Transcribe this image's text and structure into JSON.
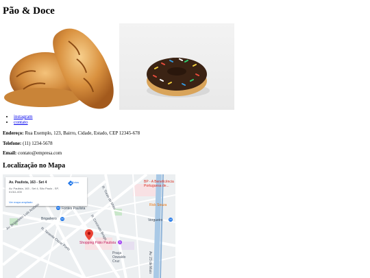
{
  "page": {
    "title": "Pão & Doce",
    "images": [
      {
        "alt": "pão",
        "icon": "bread-image"
      },
      {
        "alt": "donut",
        "icon": "donut-image"
      }
    ],
    "links": [
      "instagram",
      "contato"
    ],
    "contact": {
      "address_label": "Endereço:",
      "address": "Rua Exemplo, 123, Bairro, Cidade, Estado, CEP 12345-678",
      "phone_label": "Telefone:",
      "phone": "(11) 1234-5678",
      "email_label": "Email:",
      "email": "contato@empresa.com"
    },
    "map_heading": "Localização no Mapa"
  },
  "map": {
    "card": {
      "title": "Av. Paulista, 163 - Set 4",
      "address": "Av. Paulista, 163 - Set 4, São Paulo - SP, 01311-000",
      "link": "Ver mapa ampliado",
      "directions": "Rotas"
    },
    "labels": {
      "brigadeiro": "Brigadeiro",
      "fontes": "Fontes Paulista",
      "shopping": "Shopping Pátio Paulista",
      "praca": "Praça Oswaldo Cruz",
      "vergueiro": "Vergueiro",
      "rick": "Rick Souza",
      "benef": "BP - A Beneficência Portuguesa de...",
      "al_santos": "Al. Santos",
      "treze": "R. Treze de Maio",
      "brig_luis": "Av. Brigadeiro Luís Antônio",
      "tenente": "R. Tenente Oscar Porto",
      "st_vergueiro": "R. Vergueiro",
      "maio_23": "Av. 23 de Maio",
      "cincinato": "R. Cincinato Braga",
      "joaquim": "R. São Joaquim",
      "ruaa": "R. Santo Amaro"
    },
    "colors": {
      "water": "#a9c9e6",
      "park": "#c8e6c9",
      "pin": "#ea4335",
      "road": "#ffffff",
      "base": "#eceff1"
    }
  }
}
